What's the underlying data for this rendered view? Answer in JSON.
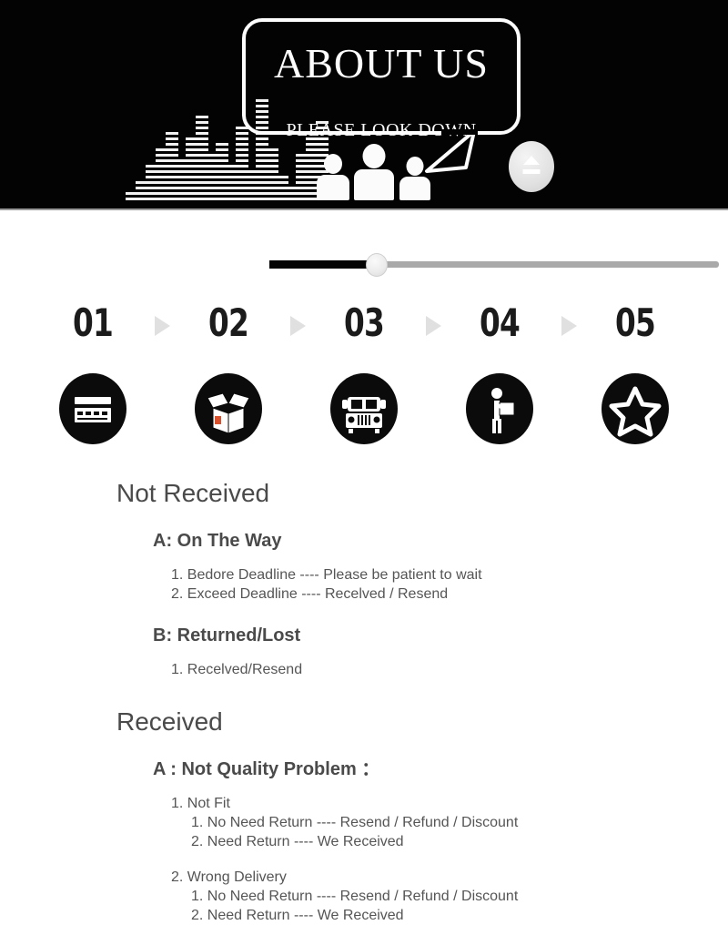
{
  "hero": {
    "bubble_title": "ABOUT US",
    "bubble_subtitle": "PLEASE LOOK DOWN",
    "eject_icon": "eject-icon",
    "equalizer_icon": "equalizer-icon",
    "people_icon": "people-group-icon",
    "background_color": "#030303",
    "accent_color": "#ffffff"
  },
  "progress_slider": {
    "filled_color": "#040404",
    "track_color": "#a9a9a9",
    "knob_position_percent": 24
  },
  "steps": [
    {
      "number": "01",
      "icon": "credit-card-icon",
      "label": "payment"
    },
    {
      "number": "02",
      "icon": "open-box-icon",
      "label": "packing"
    },
    {
      "number": "03",
      "icon": "delivery-truck-icon",
      "label": "shipping"
    },
    {
      "number": "04",
      "icon": "delivery-person-icon",
      "label": "delivery"
    },
    {
      "number": "05",
      "icon": "star-icon",
      "label": "feedback"
    }
  ],
  "arrow_icon": "triangle-right-icon",
  "sections": [
    {
      "heading": "Not Received",
      "groups": [
        {
          "label": "A: On The Way",
          "items": [
            {
              "text": "1. Bedore Deadline ---- Please be patient to wait"
            },
            {
              "text": "2. Exceed Deadline ---- Recelved / Resend"
            }
          ]
        },
        {
          "label": "B: Returned/Lost",
          "items": [
            {
              "text": "1. Recelved/Resend"
            }
          ]
        }
      ]
    },
    {
      "heading": "Received",
      "groups": [
        {
          "label": "A : Not Quality Problem ：",
          "items": [
            {
              "text": "1. Not Fit"
            },
            {
              "text": "1. No Need  Return ---- Resend / Refund / Discount",
              "sub": true
            },
            {
              "text": "2. Need  Return ---- We Received",
              "sub": true
            },
            {
              "text": "2. Wrong Delivery",
              "spaced": true
            },
            {
              "text": "1. No Need  Return ---- Resend / Refund / Discount",
              "sub": true
            },
            {
              "text": "2. Need  Return ---- We Received",
              "sub": true
            }
          ]
        }
      ]
    }
  ],
  "text_colors": {
    "heading": "#4a4a4a",
    "body": "#555555"
  }
}
